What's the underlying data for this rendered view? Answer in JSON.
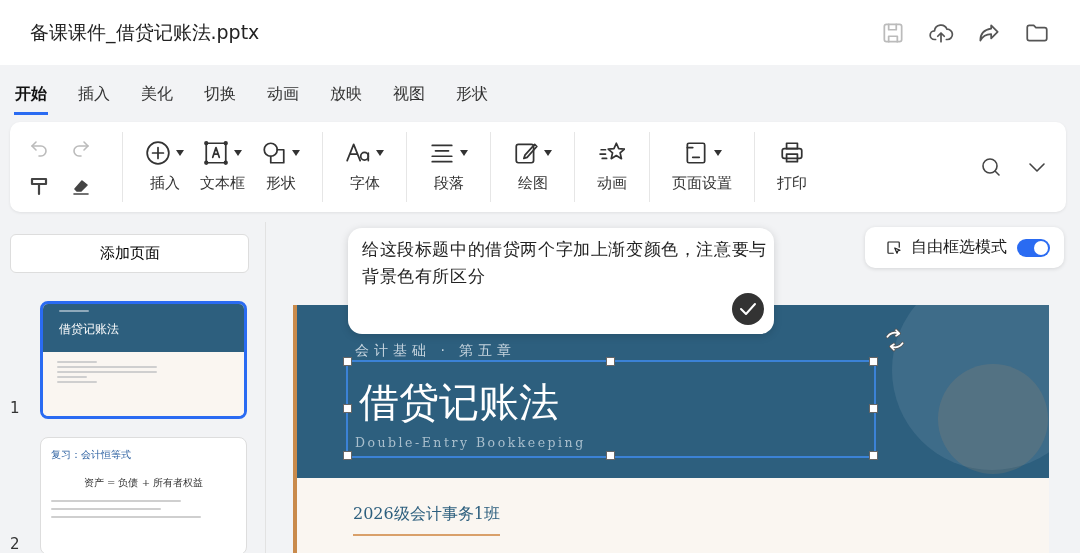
{
  "document": {
    "title": "备课课件_借贷记账法.pptx"
  },
  "header_actions": [
    {
      "kind": "save",
      "disabled": true
    },
    {
      "kind": "upload",
      "disabled": false
    },
    {
      "kind": "share",
      "disabled": false
    },
    {
      "kind": "folder",
      "disabled": false
    }
  ],
  "tabs": [
    {
      "label": "开始",
      "selected": true
    },
    {
      "label": "插入",
      "selected": false
    },
    {
      "label": "美化",
      "selected": false
    },
    {
      "label": "切换",
      "selected": false
    },
    {
      "label": "动画",
      "selected": false
    },
    {
      "label": "放映",
      "selected": false
    },
    {
      "label": "视图",
      "selected": false
    },
    {
      "label": "形状",
      "selected": false
    }
  ],
  "history": [
    {
      "kind": "undo",
      "disabled": true
    },
    {
      "kind": "redo",
      "disabled": true
    },
    {
      "kind": "painter",
      "disabled": false
    },
    {
      "kind": "eraser",
      "disabled": false
    }
  ],
  "tool_groups": [
    [
      {
        "kind": "insert",
        "label": "插入",
        "dropdown": true
      },
      {
        "kind": "textbox",
        "label": "文本框",
        "dropdown": true
      },
      {
        "kind": "shape",
        "label": "形状",
        "dropdown": true
      }
    ],
    [
      {
        "kind": "font",
        "label": "字体",
        "dropdown": true
      }
    ],
    [
      {
        "kind": "paragraph",
        "label": "段落",
        "dropdown": true
      }
    ],
    [
      {
        "kind": "draw",
        "label": "绘图",
        "dropdown": true
      }
    ],
    [
      {
        "kind": "animation",
        "label": "动画",
        "dropdown": false
      }
    ],
    [
      {
        "kind": "page",
        "label": "页面设置",
        "dropdown": true
      }
    ],
    [
      {
        "kind": "print",
        "label": "打印",
        "dropdown": false
      }
    ]
  ],
  "add_page": "添加页面",
  "slides": [
    {
      "number": "1",
      "selected": true,
      "kind": "title",
      "title": "借贷记账法"
    },
    {
      "number": "2",
      "selected": false,
      "kind": "content",
      "heading": "复习：会计恒等式",
      "title": "资产 = 负债 + 所有者权益"
    }
  ],
  "prompt": {
    "value": "给这段标题中的借贷两个字加上渐变颜色，注意要与背景色有所区分"
  },
  "free_select": {
    "label": "自由框选模式",
    "on": true
  },
  "slide": {
    "eyebrow": "会计基础 · 第五章",
    "title": "借贷记账法",
    "subtitle": "Double-Entry Bookkeeping",
    "class_name": "2026级会计事务1班",
    "title_selected": true
  }
}
